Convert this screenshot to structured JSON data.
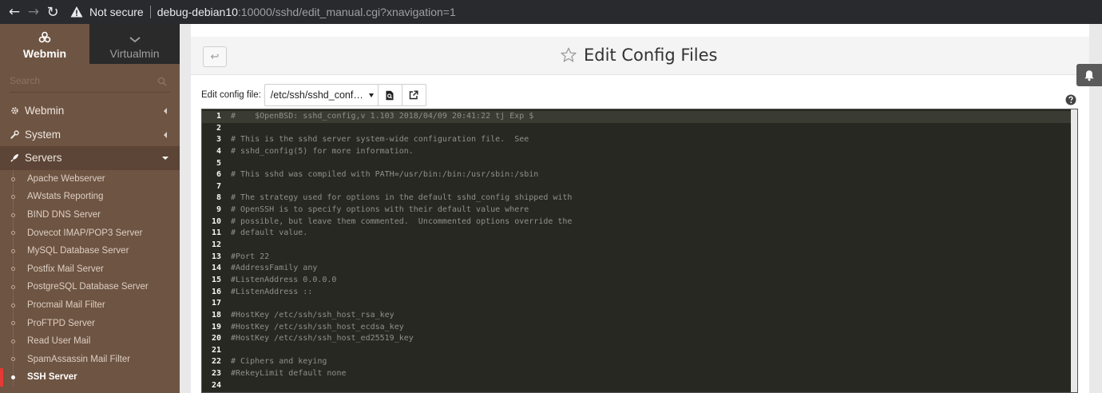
{
  "browser": {
    "security_label": "Not secure",
    "url_host": "debug-debian10",
    "url_rest": ":10000/sshd/edit_manual.cgi?xnavigation=1"
  },
  "sidebar": {
    "tabs": [
      {
        "label": "Webmin",
        "icon": "webmin-logo-icon"
      },
      {
        "label": "Virtualmin",
        "icon": "chevron-down-icon"
      }
    ],
    "search_placeholder": "Search",
    "menu": [
      {
        "label": "Webmin",
        "icon": "gear-icon",
        "open": false
      },
      {
        "label": "System",
        "icon": "wrench-icon",
        "open": false
      },
      {
        "label": "Servers",
        "icon": "rocket-icon",
        "open": true
      }
    ],
    "servers": [
      "Apache Webserver",
      "AWstats Reporting",
      "BIND DNS Server",
      "Dovecot IMAP/POP3 Server",
      "MySQL Database Server",
      "Postfix Mail Server",
      "PostgreSQL Database Server",
      "Procmail Mail Filter",
      "ProFTPD Server",
      "Read User Mail",
      "SpamAssassin Mail Filter",
      "SSH Server"
    ],
    "active_server": "SSH Server"
  },
  "page": {
    "title": "Edit Config Files",
    "config_label": "Edit config file:",
    "config_file_selected": "/etc/ssh/sshd_conf…"
  },
  "editor": {
    "lines": [
      "#\t$OpenBSD: sshd_config,v 1.103 2018/04/09 20:41:22 tj Exp $",
      "",
      "# This is the sshd server system-wide configuration file.  See",
      "# sshd_config(5) for more information.",
      "",
      "# This sshd was compiled with PATH=/usr/bin:/bin:/usr/sbin:/sbin",
      "",
      "# The strategy used for options in the default sshd_config shipped with",
      "# OpenSSH is to specify options with their default value where",
      "# possible, but leave them commented.  Uncommented options override the",
      "# default value.",
      "",
      "#Port 22",
      "#AddressFamily any",
      "#ListenAddress 0.0.0.0",
      "#ListenAddress ::",
      "",
      "#HostKey /etc/ssh/ssh_host_rsa_key",
      "#HostKey /etc/ssh/ssh_host_ecdsa_key",
      "#HostKey /etc/ssh/ssh_host_ed25519_key",
      "",
      "# Ciphers and keying",
      "#RekeyLimit default none",
      ""
    ]
  },
  "colors": {
    "sidebar_bg": "#6e5442",
    "active_marker": "#e53935",
    "editor_bg": "#272822"
  }
}
